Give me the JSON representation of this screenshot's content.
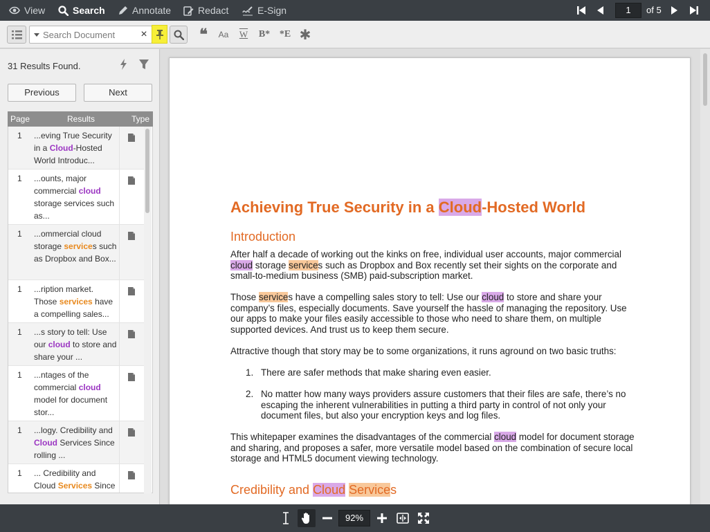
{
  "topbar": {
    "modes": [
      {
        "label": "View",
        "icon": "eye-icon"
      },
      {
        "label": "Search",
        "icon": "search-icon",
        "active": true
      },
      {
        "label": "Annotate",
        "icon": "pen-icon"
      },
      {
        "label": "Redact",
        "icon": "redact-icon"
      },
      {
        "label": "E-Sign",
        "icon": "signature-icon"
      }
    ],
    "pager": {
      "current_page": "1",
      "of_label": "of 5"
    }
  },
  "toolbar": {
    "search_placeholder": "Search Document",
    "clear_label": "×",
    "tools": [
      {
        "name": "exact-phrase-icon",
        "glyph": "❝"
      },
      {
        "name": "match-case-icon",
        "glyph": "Aa"
      },
      {
        "name": "whole-word-icon",
        "glyph": "W"
      },
      {
        "name": "begins-with-icon",
        "glyph": "B*"
      },
      {
        "name": "ends-with-icon",
        "glyph": "*E"
      },
      {
        "name": "wildcard-icon",
        "glyph": "✱"
      }
    ]
  },
  "results_panel": {
    "count_label": "31 Results Found.",
    "previous_label": "Previous",
    "next_label": "Next",
    "headers": {
      "page": "Page",
      "results": "Results",
      "type": "Type"
    },
    "rows": [
      {
        "page": "1",
        "parts": [
          [
            "...eving True Security in a ",
            ""
          ],
          [
            "Cloud",
            "p"
          ],
          [
            "-Hosted World Introduc...",
            ""
          ]
        ]
      },
      {
        "page": "1",
        "parts": [
          [
            "...ounts, major commercial ",
            ""
          ],
          [
            "cloud",
            "p"
          ],
          [
            " storage services such as...",
            ""
          ]
        ]
      },
      {
        "page": "1",
        "parts": [
          [
            "...ommercial cloud storage ",
            ""
          ],
          [
            "service",
            "o"
          ],
          [
            "s such as Dropbox and Box...",
            ""
          ]
        ]
      },
      {
        "page": "1",
        "parts": [
          [
            "...ription market. Those ",
            ""
          ],
          [
            "services",
            "o"
          ],
          [
            " have a compelling sales...",
            ""
          ]
        ]
      },
      {
        "page": "1",
        "parts": [
          [
            "...s story to tell: Use our ",
            ""
          ],
          [
            "cloud",
            "p"
          ],
          [
            " to store and share your ...",
            ""
          ]
        ]
      },
      {
        "page": "1",
        "parts": [
          [
            "...ntages of the commercial ",
            ""
          ],
          [
            "cloud",
            "p"
          ],
          [
            " model for document stor...",
            ""
          ]
        ]
      },
      {
        "page": "1",
        "parts": [
          [
            "...logy. Credibility and ",
            ""
          ],
          [
            "Cloud",
            "p"
          ],
          [
            " Services Since rolling ...",
            ""
          ]
        ]
      },
      {
        "page": "1",
        "parts": [
          [
            "... Credibility and Cloud ",
            ""
          ],
          [
            "Services",
            "o"
          ],
          [
            " Since",
            ""
          ]
        ]
      }
    ]
  },
  "document": {
    "title_pre": "Achieving True Security in a ",
    "title_hl": "Cloud",
    "title_post": "-Hosted World",
    "h_intro": "Introduction",
    "p1": [
      [
        "After half a decade of working out the kinks on free, individual user accounts, major commercial ",
        ""
      ],
      [
        "cloud",
        "p"
      ],
      [
        " storage ",
        ""
      ],
      [
        "service",
        "o"
      ],
      [
        "s such as Dropbox and Box recently set their sights on the corporate and small-to-medium business (SMB) paid-subscription market.",
        ""
      ]
    ],
    "p2": [
      [
        "Those ",
        ""
      ],
      [
        "service",
        "o"
      ],
      [
        "s have a compelling sales story to tell: Use our ",
        ""
      ],
      [
        "cloud",
        "p"
      ],
      [
        " to store and share your company’s files, especially documents. Save yourself the hassle of managing the repository. Use our apps to make your files easily accessible to those who need to share them, on multiple supported devices. And trust us to keep them secure.",
        ""
      ]
    ],
    "p3": "Attractive though that story may be to some organizations, it runs aground on two basic truths:",
    "list": [
      {
        "n": "1.",
        "text": "There are safer methods that make sharing even easier."
      },
      {
        "n": "2.",
        "text": "No matter how many ways providers assure customers that their files are safe, there’s no escaping the inherent vulnerabilities in putting a third party in control of not only your document files, but also your encryption keys and log files."
      }
    ],
    "p4": [
      [
        "This whitepaper examines the disadvantages of the commercial ",
        ""
      ],
      [
        "cloud",
        "p"
      ],
      [
        " model for document storage and sharing, and proposes a safer, more versatile model based on the combination of secure local storage and HTML5 document viewing technology.",
        ""
      ]
    ],
    "h_cred_pre": "Credibility and ",
    "h_cred_hl1": "Cloud",
    "h_cred_hl2": "Service",
    "h_cred_post": "s"
  },
  "bottombar": {
    "zoom": "92%",
    "tools": [
      "text-select-icon",
      "pan-hand-icon",
      "zoom-out-icon",
      "zoom-in-icon",
      "fit-width-icon",
      "fullscreen-icon"
    ]
  },
  "colors": {
    "accent_orange": "#e26a24",
    "hit_purple": "#9b36c2",
    "hit_orange": "#e8891e",
    "pin_yellow": "#f7ef38"
  }
}
